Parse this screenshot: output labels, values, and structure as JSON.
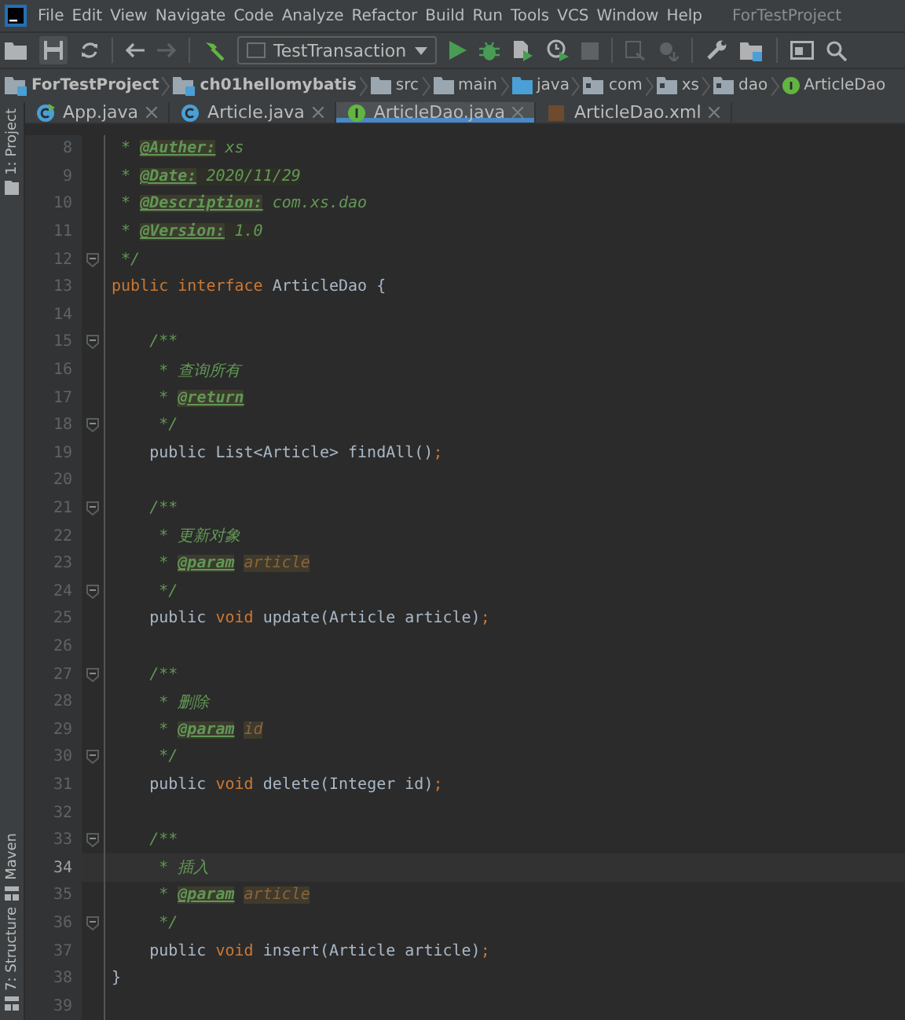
{
  "menu": {
    "items": [
      "File",
      "Edit",
      "View",
      "Navigate",
      "Code",
      "Analyze",
      "Refactor",
      "Build",
      "Run",
      "Tools",
      "VCS",
      "Window",
      "Help"
    ],
    "project_title": "ForTestProject"
  },
  "toolbar": {
    "run_config": "TestTransaction"
  },
  "breadcrumbs": [
    {
      "label": "ForTestProject",
      "kind": "module"
    },
    {
      "label": "ch01hellomybatis",
      "kind": "module"
    },
    {
      "label": "src",
      "kind": "folder"
    },
    {
      "label": "main",
      "kind": "folder"
    },
    {
      "label": "java",
      "kind": "source"
    },
    {
      "label": "com",
      "kind": "package"
    },
    {
      "label": "xs",
      "kind": "package"
    },
    {
      "label": "dao",
      "kind": "package"
    },
    {
      "label": "ArticleDao",
      "kind": "interface"
    }
  ],
  "tool_strip": {
    "top": [
      "1: Project"
    ],
    "bottom": [
      "Maven",
      "7: Structure"
    ]
  },
  "tabs": [
    {
      "label": "App.java",
      "kind": "runnable",
      "selected": false
    },
    {
      "label": "Article.java",
      "kind": "class",
      "selected": false
    },
    {
      "label": "ArticleDao.java",
      "kind": "interface",
      "selected": true
    },
    {
      "label": "ArticleDao.xml",
      "kind": "xml",
      "selected": false
    }
  ],
  "lines": [
    {
      "n": "8",
      "fold": false,
      "current": false,
      "segs": [
        {
          "kind": "cmt",
          "text": " * "
        },
        {
          "kind": "tag",
          "text": "@Auther:"
        },
        {
          "kind": "cmt",
          "text": " xs"
        }
      ]
    },
    {
      "n": "9",
      "fold": false,
      "current": false,
      "segs": [
        {
          "kind": "cmt",
          "text": " * "
        },
        {
          "kind": "tag",
          "text": "@Date:"
        },
        {
          "kind": "tagval",
          "text": " 2020/11/29"
        }
      ]
    },
    {
      "n": "10",
      "fold": false,
      "current": false,
      "segs": [
        {
          "kind": "cmt",
          "text": " * "
        },
        {
          "kind": "tag",
          "text": "@Description:"
        },
        {
          "kind": "cmt",
          "text": " com.xs.dao"
        }
      ]
    },
    {
      "n": "11",
      "fold": false,
      "current": false,
      "segs": [
        {
          "kind": "cmt",
          "text": " * "
        },
        {
          "kind": "tag",
          "text": "@Version:"
        },
        {
          "kind": "tagval",
          "text": " 1.0"
        }
      ]
    },
    {
      "n": "12",
      "fold": true,
      "current": false,
      "segs": [
        {
          "kind": "cmt",
          "text": " */"
        }
      ]
    },
    {
      "n": "13",
      "fold": false,
      "current": false,
      "segs": [
        {
          "kind": "kw",
          "text": "public interface "
        },
        {
          "kind": "text",
          "text": "ArticleDao {"
        }
      ]
    },
    {
      "n": "14",
      "fold": false,
      "current": false
    },
    {
      "n": "15",
      "fold": true,
      "current": false,
      "segs": [
        {
          "kind": "cmt",
          "text": "    /**"
        }
      ]
    },
    {
      "n": "16",
      "fold": false,
      "current": false,
      "segs": [
        {
          "kind": "cmt",
          "text": "     * 查询所有"
        }
      ]
    },
    {
      "n": "17",
      "fold": false,
      "current": false,
      "segs": [
        {
          "kind": "cmt",
          "text": "     * "
        },
        {
          "kind": "tag",
          "text": "@return"
        }
      ]
    },
    {
      "n": "18",
      "fold": true,
      "current": false,
      "segs": [
        {
          "kind": "cmt",
          "text": "     */"
        }
      ]
    },
    {
      "n": "19",
      "fold": false,
      "current": false,
      "segs": [
        {
          "kind": "text",
          "text": "    public List<Article> findAll()"
        },
        {
          "kind": "kw",
          "text": ";"
        }
      ]
    },
    {
      "n": "20",
      "fold": false,
      "current": false
    },
    {
      "n": "21",
      "fold": true,
      "current": false,
      "segs": [
        {
          "kind": "cmt",
          "text": "    /**"
        }
      ]
    },
    {
      "n": "22",
      "fold": false,
      "current": false,
      "segs": [
        {
          "kind": "cmt",
          "text": "     * 更新对象"
        }
      ]
    },
    {
      "n": "23",
      "fold": false,
      "current": false,
      "segs": [
        {
          "kind": "cmt",
          "text": "     * "
        },
        {
          "kind": "tag",
          "text": "@param"
        },
        {
          "kind": "pname",
          "text": "article"
        }
      ]
    },
    {
      "n": "24",
      "fold": true,
      "current": false,
      "segs": [
        {
          "kind": "cmt",
          "text": "     */"
        }
      ]
    },
    {
      "n": "25",
      "fold": false,
      "current": false,
      "segs": [
        {
          "kind": "text",
          "text": "    public "
        },
        {
          "kind": "kw",
          "text": "void "
        },
        {
          "kind": "text",
          "text": "update(Article article)"
        },
        {
          "kind": "kw",
          "text": ";"
        }
      ]
    },
    {
      "n": "26",
      "fold": false,
      "current": false
    },
    {
      "n": "27",
      "fold": true,
      "current": false,
      "segs": [
        {
          "kind": "cmt",
          "text": "    /**"
        }
      ]
    },
    {
      "n": "28",
      "fold": false,
      "current": false,
      "segs": [
        {
          "kind": "cmt",
          "text": "     * 删除"
        }
      ]
    },
    {
      "n": "29",
      "fold": false,
      "current": false,
      "segs": [
        {
          "kind": "cmt",
          "text": "     * "
        },
        {
          "kind": "tag",
          "text": "@param"
        },
        {
          "kind": "pname",
          "text": "id"
        }
      ]
    },
    {
      "n": "30",
      "fold": true,
      "current": false,
      "segs": [
        {
          "kind": "cmt",
          "text": "     */"
        }
      ]
    },
    {
      "n": "31",
      "fold": false,
      "current": false,
      "segs": [
        {
          "kind": "text",
          "text": "    public "
        },
        {
          "kind": "kw",
          "text": "void "
        },
        {
          "kind": "text",
          "text": "delete(Integer id)"
        },
        {
          "kind": "kw",
          "text": ";"
        }
      ]
    },
    {
      "n": "32",
      "fold": false,
      "current": false
    },
    {
      "n": "33",
      "fold": true,
      "current": false,
      "segs": [
        {
          "kind": "cmt",
          "text": "    /**"
        }
      ]
    },
    {
      "n": "34",
      "fold": false,
      "current": true,
      "segs": [
        {
          "kind": "cmt",
          "text": "     * 插入"
        }
      ]
    },
    {
      "n": "35",
      "fold": false,
      "current": false,
      "segs": [
        {
          "kind": "cmt",
          "text": "     * "
        },
        {
          "kind": "tag",
          "text": "@param"
        },
        {
          "kind": "pname",
          "text": "article"
        }
      ]
    },
    {
      "n": "36",
      "fold": true,
      "current": false,
      "segs": [
        {
          "kind": "cmt",
          "text": "     */"
        }
      ]
    },
    {
      "n": "37",
      "fold": false,
      "current": false,
      "segs": [
        {
          "kind": "text",
          "text": "    public "
        },
        {
          "kind": "kw",
          "text": "void "
        },
        {
          "kind": "text",
          "text": "insert(Article article)"
        },
        {
          "kind": "kw",
          "text": ";"
        }
      ]
    },
    {
      "n": "38",
      "fold": false,
      "current": false,
      "segs": [
        {
          "kind": "text",
          "text": "}"
        }
      ]
    },
    {
      "n": "39",
      "fold": false,
      "current": false
    }
  ]
}
